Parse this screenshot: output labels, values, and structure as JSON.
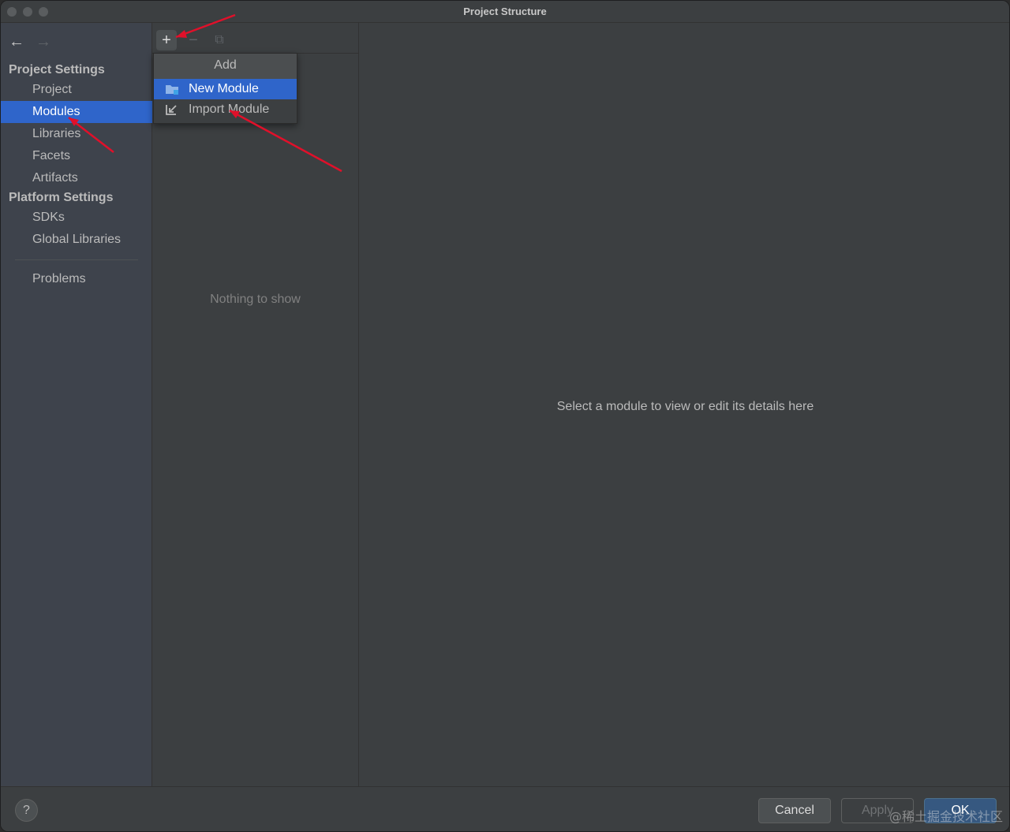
{
  "window": {
    "title": "Project Structure"
  },
  "nav": {
    "back_icon": "←",
    "forward_icon": "→"
  },
  "sidebar": {
    "project_settings_header": "Project Settings",
    "project_items": [
      "Project",
      "Modules",
      "Libraries",
      "Facets",
      "Artifacts"
    ],
    "selected_item": "Modules",
    "platform_settings_header": "Platform Settings",
    "platform_items": [
      "SDKs",
      "Global Libraries"
    ],
    "problems_label": "Problems"
  },
  "toolbar": {
    "add_icon": "+",
    "remove_icon": "−",
    "copy_icon": "⧉"
  },
  "middle": {
    "empty_text": "Nothing to show"
  },
  "details": {
    "placeholder": "Select a module to view or edit its details here"
  },
  "add_popup": {
    "header": "Add",
    "items": [
      {
        "label": "New Module",
        "icon": "folder-module-icon"
      },
      {
        "label": "Import Module",
        "icon": "import-arrow-icon"
      }
    ]
  },
  "footer": {
    "help_label": "?",
    "cancel_label": "Cancel",
    "apply_label": "Apply",
    "ok_label": "OK"
  },
  "watermark": "@稀土掘金技术社区",
  "colors": {
    "selection": "#2f65ca",
    "annotation_arrow": "#e0102a"
  }
}
